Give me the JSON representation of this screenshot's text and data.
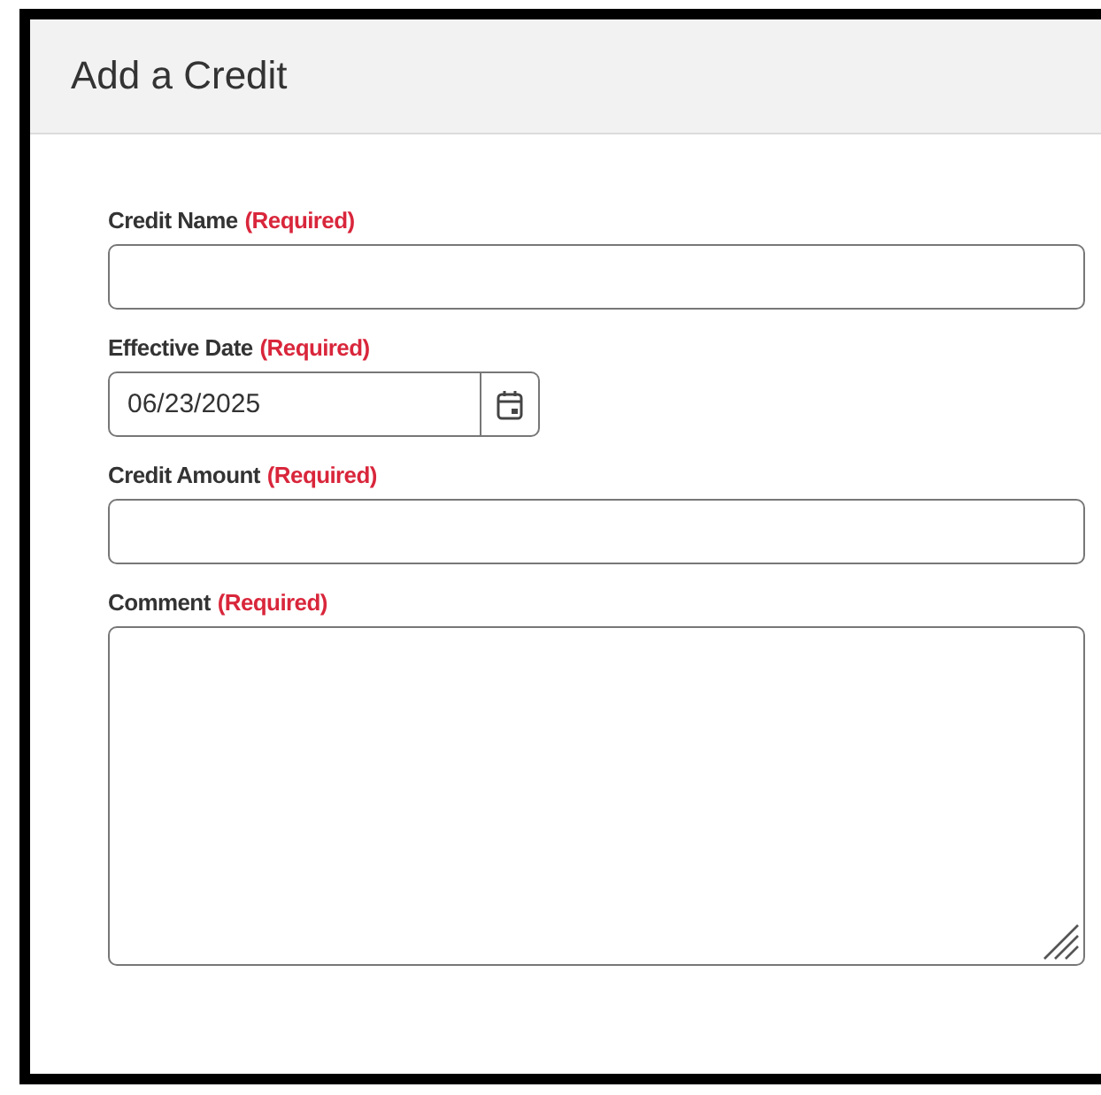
{
  "dialog": {
    "title": "Add a Credit"
  },
  "fields": [
    {
      "kind": "text",
      "label": "Credit Name",
      "required_note": "(Required)"
    },
    {
      "kind": "date",
      "label": "Effective Date",
      "required_note": "(Required)",
      "value": "06/23/2025"
    },
    {
      "kind": "text",
      "label": "Credit Amount",
      "required_note": "(Required)"
    },
    {
      "kind": "textarea",
      "label": "Comment",
      "required_note": "(Required)"
    }
  ]
}
